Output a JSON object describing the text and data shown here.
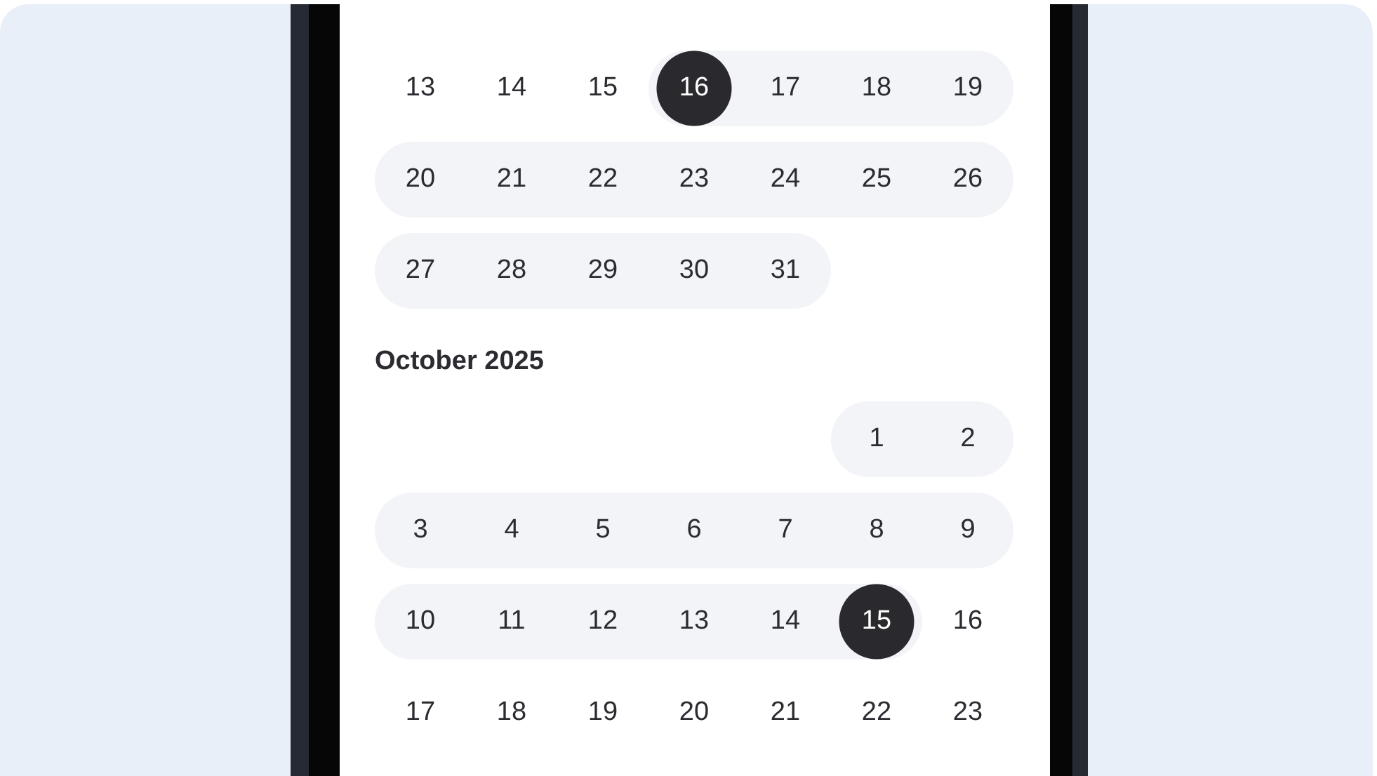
{
  "months": [
    {
      "weeks": [
        {
          "days": [
            {
              "day": "13",
              "in_range": false,
              "selected": false
            },
            {
              "day": "14",
              "in_range": false,
              "selected": false
            },
            {
              "day": "15",
              "in_range": false,
              "selected": false
            },
            {
              "day": "16",
              "in_range": true,
              "selected": true
            },
            {
              "day": "17",
              "in_range": true,
              "selected": false
            },
            {
              "day": "18",
              "in_range": true,
              "selected": false
            },
            {
              "day": "19",
              "in_range": true,
              "selected": false
            }
          ]
        },
        {
          "days": [
            {
              "day": "20",
              "in_range": true,
              "selected": false
            },
            {
              "day": "21",
              "in_range": true,
              "selected": false
            },
            {
              "day": "22",
              "in_range": true,
              "selected": false
            },
            {
              "day": "23",
              "in_range": true,
              "selected": false
            },
            {
              "day": "24",
              "in_range": true,
              "selected": false
            },
            {
              "day": "25",
              "in_range": true,
              "selected": false
            },
            {
              "day": "26",
              "in_range": true,
              "selected": false
            }
          ]
        },
        {
          "days": [
            {
              "day": "27",
              "in_range": true,
              "selected": false
            },
            {
              "day": "28",
              "in_range": true,
              "selected": false
            },
            {
              "day": "29",
              "in_range": true,
              "selected": false
            },
            {
              "day": "30",
              "in_range": true,
              "selected": false
            },
            {
              "day": "31",
              "in_range": true,
              "selected": false
            }
          ]
        }
      ]
    },
    {
      "title": "October 2025",
      "weeks": [
        {
          "right_aligned": true,
          "days": [
            {
              "day": "1",
              "in_range": true,
              "selected": false
            },
            {
              "day": "2",
              "in_range": true,
              "selected": false
            }
          ]
        },
        {
          "days": [
            {
              "day": "3",
              "in_range": true,
              "selected": false
            },
            {
              "day": "4",
              "in_range": true,
              "selected": false
            },
            {
              "day": "5",
              "in_range": true,
              "selected": false
            },
            {
              "day": "6",
              "in_range": true,
              "selected": false
            },
            {
              "day": "7",
              "in_range": true,
              "selected": false
            },
            {
              "day": "8",
              "in_range": true,
              "selected": false
            },
            {
              "day": "9",
              "in_range": true,
              "selected": false
            }
          ]
        },
        {
          "days": [
            {
              "day": "10",
              "in_range": true,
              "selected": false
            },
            {
              "day": "11",
              "in_range": true,
              "selected": false
            },
            {
              "day": "12",
              "in_range": true,
              "selected": false
            },
            {
              "day": "13",
              "in_range": true,
              "selected": false
            },
            {
              "day": "14",
              "in_range": true,
              "selected": false
            },
            {
              "day": "15",
              "in_range": true,
              "selected": true
            },
            {
              "day": "16",
              "in_range": false,
              "selected": false
            }
          ]
        },
        {
          "days": [
            {
              "day": "17",
              "in_range": false,
              "selected": false
            },
            {
              "day": "18",
              "in_range": false,
              "selected": false
            },
            {
              "day": "19",
              "in_range": false,
              "selected": false
            },
            {
              "day": "20",
              "in_range": false,
              "selected": false
            },
            {
              "day": "21",
              "in_range": false,
              "selected": false
            },
            {
              "day": "22",
              "in_range": false,
              "selected": false
            },
            {
              "day": "23",
              "in_range": false,
              "selected": false
            }
          ]
        }
      ]
    }
  ]
}
